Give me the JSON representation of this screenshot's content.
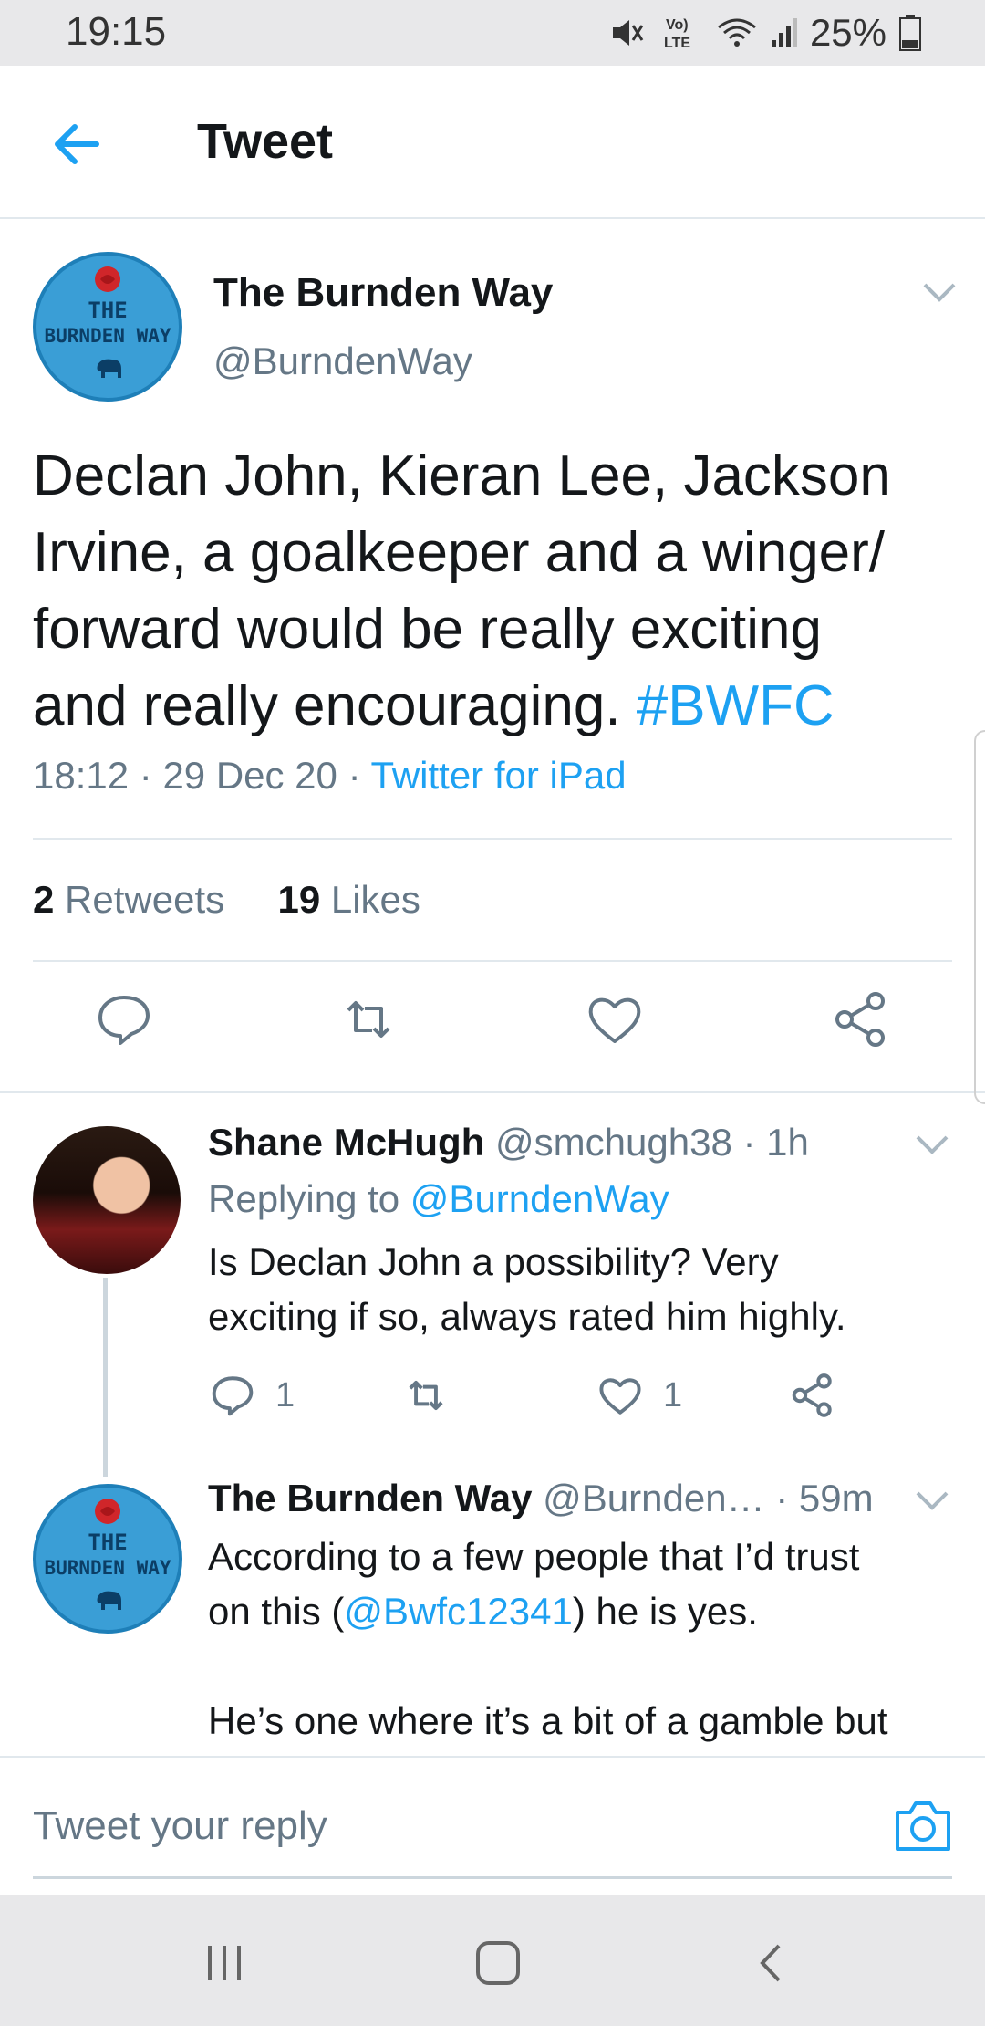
{
  "status_bar": {
    "time": "19:15",
    "battery": "25%",
    "lte_label": "LTE"
  },
  "header": {
    "title": "Tweet"
  },
  "main_tweet": {
    "author_name": "The Burnden Way",
    "author_handle": "@BurndenWay",
    "avatar_text_line1": "THE",
    "avatar_text_line2": "BURNDEN WAY",
    "text_lines": [
      "Declan John, Kieran Lee, Jackson",
      "Irvine, a goalkeeper and a winger/",
      "forward would be really exciting"
    ],
    "text_last_line": "and really encouraging.",
    "hashtag": "#BWFC",
    "time": "18:12",
    "date": "29 Dec 20",
    "source": "Twitter for iPad",
    "retweets_count": "2",
    "retweets_label": "Retweets",
    "likes_count": "19",
    "likes_label": "Likes"
  },
  "reply_1": {
    "author_name": "Shane McHugh",
    "author_handle": "@smchugh38",
    "age": "1h",
    "replying_to_label": "Replying to",
    "replying_to_handle": "@BurndenWay",
    "text_lines": [
      "Is Declan John a possibility? Very",
      "exciting if so, always rated him highly."
    ],
    "reply_count": "1",
    "like_count": "1"
  },
  "reply_2": {
    "author_name": "The Burnden Way",
    "author_handle": "@Burnden…",
    "age": "59m",
    "text_line1": "According to a few people that I’d trust",
    "text_line2_pre": "on this (",
    "mention": "@Bwfc12341",
    "text_line2_post": ") he is yes.",
    "text_line3": "He’s one where it’s a bit of a gamble but"
  },
  "composer": {
    "placeholder": "Tweet your reply"
  },
  "colors": {
    "accent": "#1da1f2",
    "muted": "#657786",
    "text": "#14171a",
    "divider": "#e1e8ed"
  },
  "icons": {
    "back": "arrow-left-icon",
    "reply": "speech-bubble-icon",
    "retweet": "retweet-icon",
    "like": "heart-icon",
    "share": "share-icon",
    "camera": "camera-icon",
    "chevron": "chevron-down-icon"
  }
}
